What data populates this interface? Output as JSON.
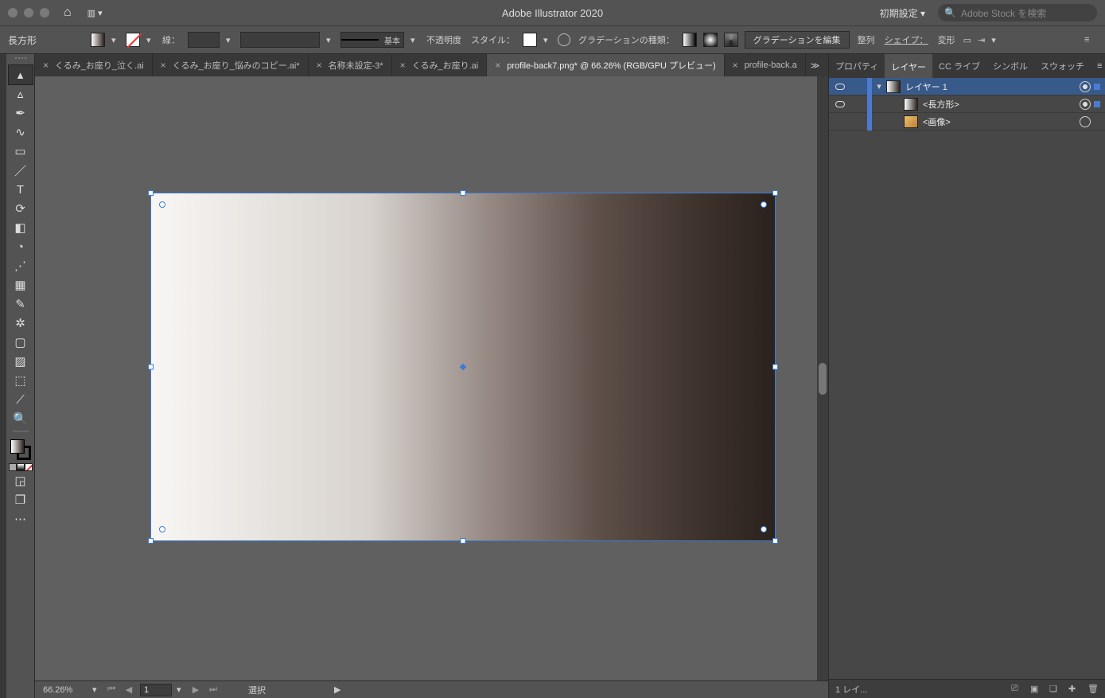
{
  "titlebar": {
    "app_title": "Adobe Illustrator 2020",
    "workspace_preset": "初期設定",
    "stock_placeholder": "Adobe Stock を検索"
  },
  "ctrl": {
    "object_kind": "長方形",
    "stroke_label": "線：",
    "brush_label": "基本",
    "opacity_label": "不透明度",
    "style_label": "スタイル：",
    "gradienttype_label": "グラデーションの種類：",
    "edit_gradient_btn": "グラデーションを編集",
    "align_label": "整列",
    "shape_label": "シェイプ：",
    "transform_label": "変形"
  },
  "tabs": {
    "items": [
      {
        "label": "くるみ_お座り_泣く.ai"
      },
      {
        "label": "くるみ_お座り_悩みのコピー.ai*"
      },
      {
        "label": "名称未設定-3*"
      },
      {
        "label": "くるみ_お座り.ai"
      },
      {
        "label": "profile-back7.png* @ 66.26% (RGB/GPU プレビュー)"
      },
      {
        "label": "profile-back.a"
      }
    ],
    "more": "≫"
  },
  "panels": {
    "tabs": [
      "プロパティ",
      "レイヤー",
      "CC ライブ",
      "シンボル",
      "スウォッチ"
    ],
    "active": 1,
    "layers": [
      {
        "name": "レイヤー 1",
        "indent": 0,
        "selected": true,
        "expand": "▾",
        "thumb": "grad",
        "target": true,
        "sel": true
      },
      {
        "name": "<長方形>",
        "indent": 1,
        "selected": false,
        "expand": "",
        "thumb": "grad",
        "target": true,
        "sel": true
      },
      {
        "name": "<画像>",
        "indent": 1,
        "selected": false,
        "expand": "",
        "thumb": "img",
        "target": false,
        "sel": false
      }
    ],
    "footer_count": "1 レイ..."
  },
  "status": {
    "zoom": "66.26%",
    "artboard": "1",
    "selection_mode": "選択"
  }
}
